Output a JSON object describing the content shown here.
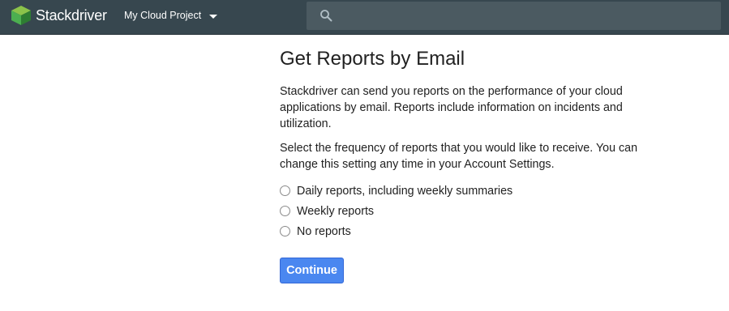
{
  "header": {
    "brand": "Stackdriver",
    "project": "My Cloud Project",
    "search": {
      "value": "",
      "placeholder": ""
    }
  },
  "main": {
    "title": "Get Reports by Email",
    "description": "Stackdriver can send you reports on the performance of your cloud applications by email. Reports include information on incidents and utilization.",
    "instruction": "Select the frequency of reports that you would like to receive. You can change this setting any time in your Account Settings.",
    "options": [
      {
        "label": "Daily reports, including weekly summaries"
      },
      {
        "label": "Weekly reports"
      },
      {
        "label": "No reports"
      }
    ],
    "continue_label": "Continue"
  },
  "colors": {
    "topbar": "#37474f",
    "search_bg": "#4b5a61",
    "primary_button": "#4a87f0",
    "logo_green": "#4caf50"
  }
}
